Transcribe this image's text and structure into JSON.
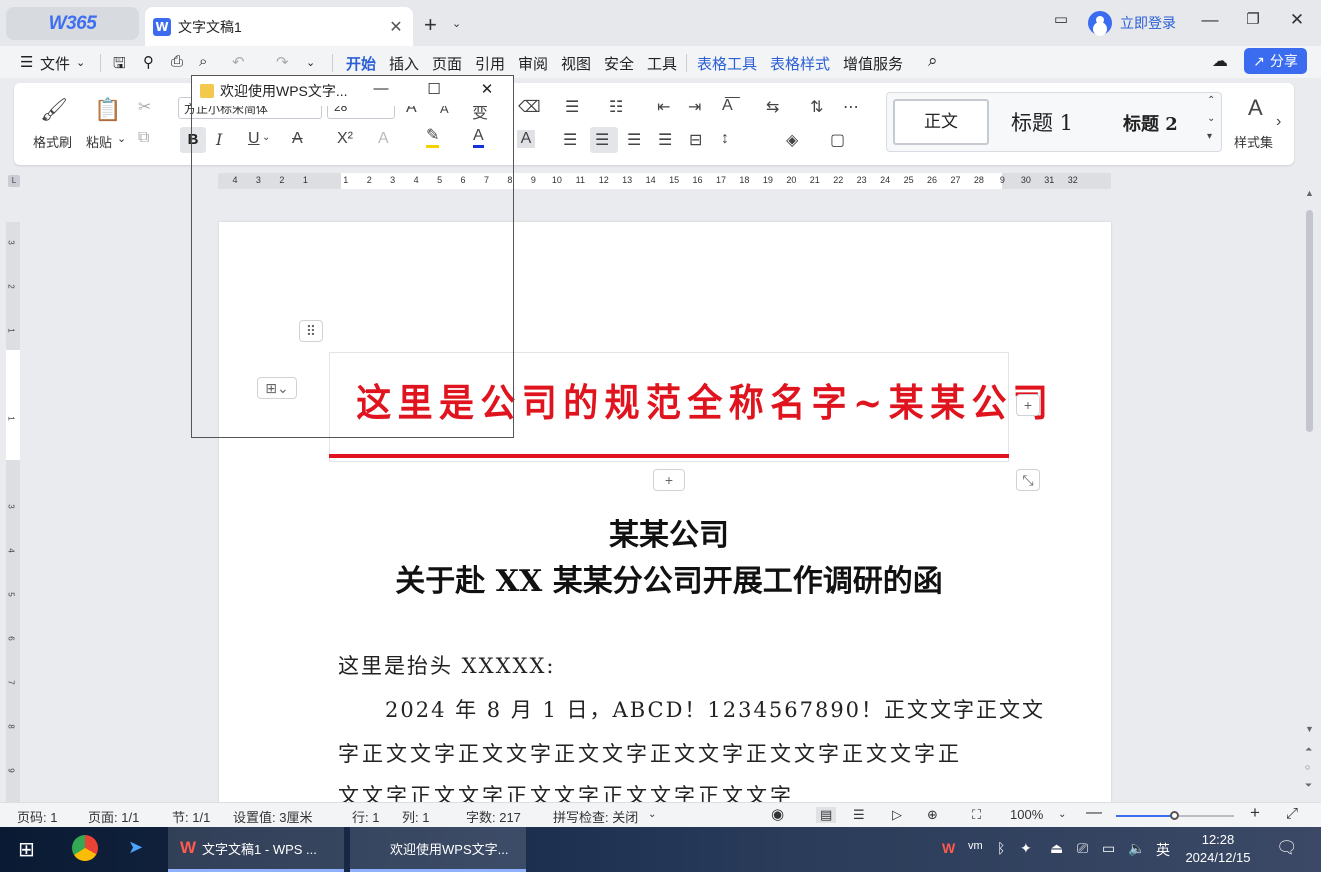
{
  "titlebar": {
    "brand": "W365",
    "doc_tab": "文字文稿1",
    "doc_tab_icon": "W",
    "login": "立即登录"
  },
  "menubar": {
    "file": "文件",
    "items": [
      "开始",
      "插入",
      "页面",
      "引用",
      "审阅",
      "视图",
      "安全",
      "工具"
    ],
    "context_items": [
      "表格工具",
      "表格样式"
    ],
    "extra": "增值服务",
    "share": "分享"
  },
  "ribbon": {
    "format_painter": "格式刷",
    "paste": "粘贴",
    "font_name": "方正小标宋简体",
    "font_size": "28",
    "styles": {
      "normal": "正文",
      "heading1": "标题 1",
      "heading2": "标题 2"
    },
    "style_set": "样式集"
  },
  "ruler": {
    "h_ticks": [
      "4",
      "3",
      "2",
      "1",
      "1",
      "2",
      "3",
      "4",
      "5",
      "6",
      "7",
      "8",
      "9",
      "10",
      "11",
      "12",
      "13",
      "14",
      "15",
      "16",
      "17",
      "18",
      "19",
      "20",
      "21",
      "22",
      "23",
      "24",
      "25",
      "26",
      "27",
      "28",
      "9",
      "30",
      "31",
      "32"
    ],
    "v_ticks": [
      "3",
      "2",
      "1",
      "1",
      "3",
      "4",
      "5",
      "6",
      "7",
      "8",
      "9"
    ]
  },
  "popup": {
    "title": "欢迎使用WPS文字..."
  },
  "document": {
    "company_banner": "这里是公司的规范全称名字~某某公司",
    "heading_line1": "某某公司",
    "heading_line2": "关于赴 XX 某某分公司开展工作调研的函",
    "salutation": "这里是抬头 XXXXX:",
    "body_line1": "2024 年 8 月 1 日，ABCD！1234567890！正文文字正文文",
    "body_line2": "字正文文字正文文字正文文字正文文字正文文字正文文字正",
    "body_line3": "文文字正文文字正文文字正文文字正文文字"
  },
  "statusbar": {
    "page_num": "页码: 1",
    "pages": "页面: 1/1",
    "section": "节: 1/1",
    "setting": "设置值: 3厘米",
    "row": "行: 1",
    "col": "列: 1",
    "word_count": "字数: 217",
    "spell_check": "拼写检查: 关闭",
    "zoom": "100%",
    "zoom_level": 0.5
  },
  "taskbar": {
    "wps_task": "文字文稿1 - WPS ...",
    "popup_task": "欢迎使用WPS文字...",
    "ime": "英",
    "time": "12:28",
    "date": "2024/12/15"
  },
  "colors": {
    "accent": "#3b6cf0",
    "banner_red": "#e0141e"
  }
}
